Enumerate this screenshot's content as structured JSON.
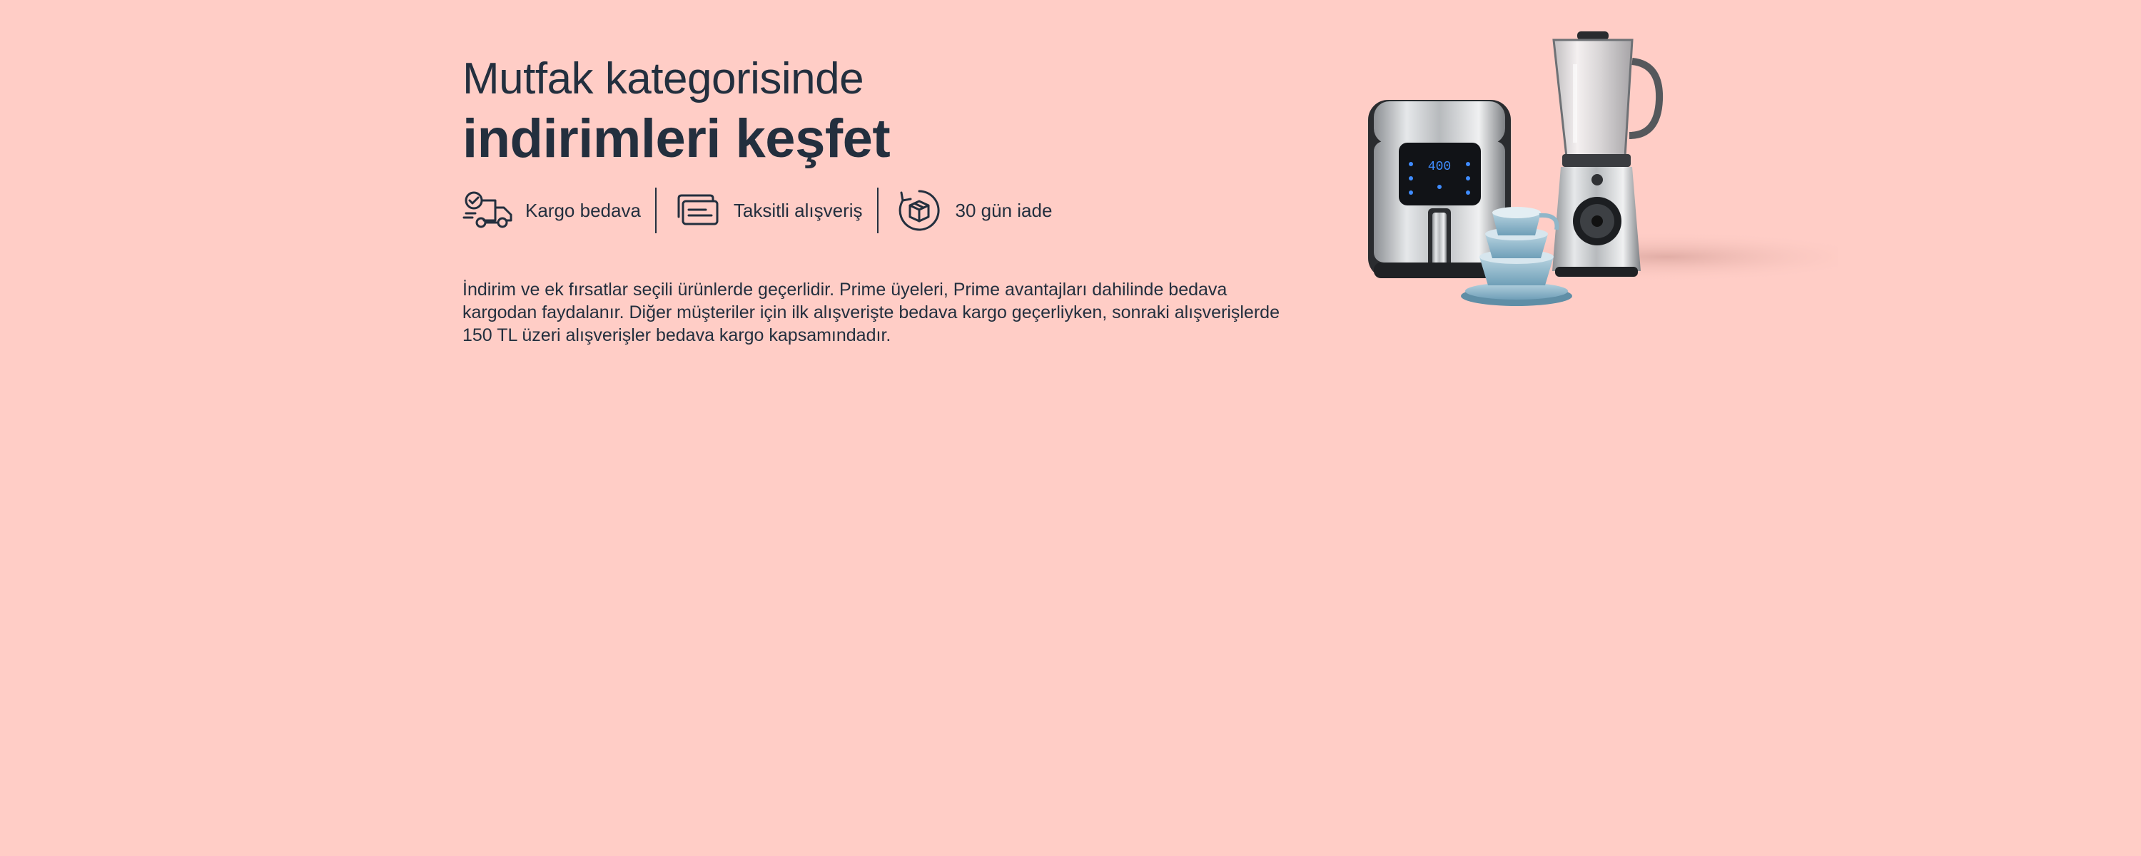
{
  "banner": {
    "background_color": "#ffcdc6",
    "text_color": "#232f3e",
    "headline_line1": "Mutfak kategorisinde",
    "headline_line2": "indirimleri keşfet",
    "features": [
      {
        "icon": "delivery-truck-icon",
        "label": "Kargo bedava"
      },
      {
        "icon": "credit-card-installments-icon",
        "label": "Taksitli alışveriş"
      },
      {
        "icon": "box-return-icon",
        "label": "30 gün iade"
      }
    ],
    "disclaimer": "İndirim ve ek fırsatlar seçili ürünlerde geçerlidir. Prime üyeleri, Prime avantajları dahilinde bedava kargodan faydalanır. Diğer müşteriler için ilk alışverişte bedava kargo geçerliyken, sonraki alışverişlerde 150 TL üzeri alışverişler bedava kargo kapsamındadır.",
    "product_display": {
      "airfryer_display": "400"
    }
  }
}
